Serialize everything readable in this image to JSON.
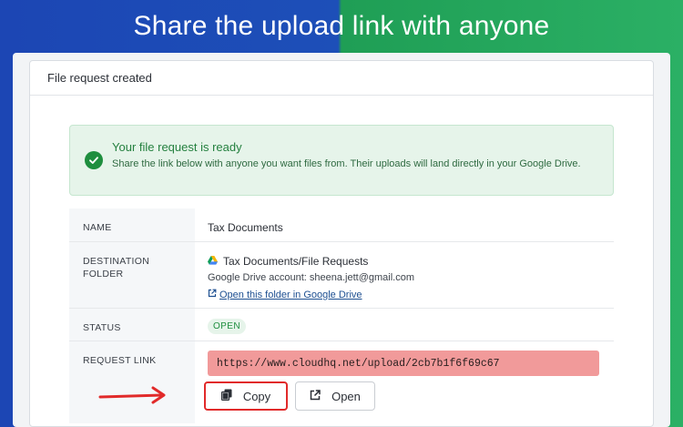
{
  "banner": {
    "title": "Share the upload link with anyone"
  },
  "card": {
    "header": "File request created"
  },
  "alert": {
    "title": "Your file request is ready",
    "text": "Share the link below with anyone you want files from. Their uploads will land directly in your Google Drive."
  },
  "details": {
    "name_label": "NAME",
    "name_value": "Tax Documents",
    "dest_label": "DESTINATION FOLDER",
    "dest_path": "Tax Documents/File Requests",
    "dest_account": "Google Drive account: sheena.jett@gmail.com",
    "dest_open_link": "Open this folder in Google Drive",
    "status_label": "STATUS",
    "status_value": "OPEN",
    "link_label": "REQUEST LINK",
    "link_value": "https://www.cloudhq.net/upload/2cb7b1f6f69c67"
  },
  "buttons": {
    "copy": "Copy",
    "open": "Open"
  },
  "colors": {
    "banner_left": "#1c46b4",
    "banner_right": "#2bb065",
    "link_highlight": "#f19a9a",
    "copy_highlight": "#e12a2a",
    "success": "#1e8e3e"
  },
  "icons": [
    "check-circle-icon",
    "google-drive-icon",
    "external-link-icon",
    "copy-icon",
    "open-external-icon",
    "red-arrow-icon"
  ]
}
